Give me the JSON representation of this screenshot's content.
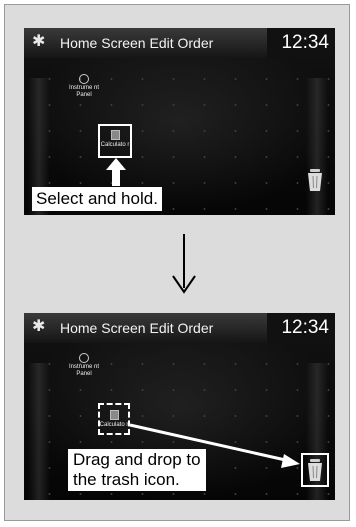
{
  "screen_top": {
    "title": "Home Screen Edit Order",
    "time": "12:34",
    "apps": {
      "instrument_panel": "Instrume nt Panel",
      "calculator": "Calculato r"
    },
    "callout": "Select and hold."
  },
  "screen_bottom": {
    "title": "Home Screen Edit Order",
    "time": "12:34",
    "apps": {
      "instrument_panel": "Instrume nt Panel",
      "calculator": "Calculato r"
    },
    "callout_line1": "Drag and drop to",
    "callout_line2": "the trash icon."
  },
  "icons": {
    "settings": "gear-icon",
    "trash": "trash-icon",
    "instrument_panel": "gauge-icon",
    "calculator": "calculator-icon",
    "flow": "down-arrow-icon"
  },
  "colors": {
    "screen_bg": "#000000",
    "panel_bg": "#dcdcdc",
    "highlight": "#ffffff"
  }
}
